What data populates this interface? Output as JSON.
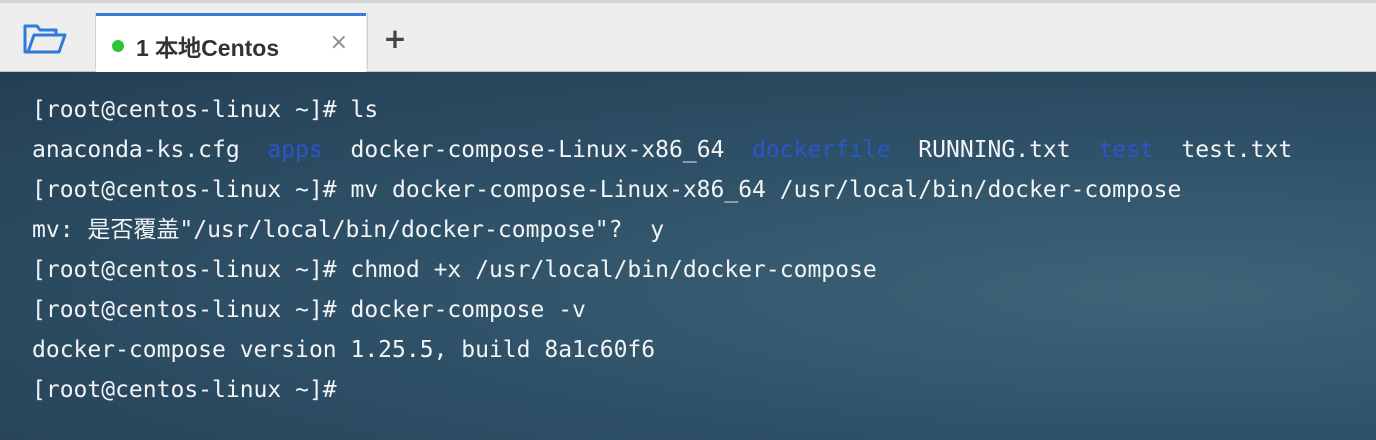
{
  "tabbar": {
    "folder_icon": "folder-open-icon",
    "tab": {
      "label": "1 本地Centos",
      "status": "connected",
      "close_icon": "×"
    },
    "add_tab_icon": "+"
  },
  "colors": {
    "tab_accent": "#3a7bd5",
    "status_dot": "#2ec438",
    "directory_text": "#2a56c8",
    "terminal_text": "#f2f4f6"
  },
  "terminal": {
    "lines": {
      "l1": "[root@centos-linux ~]# ls",
      "l2": {
        "f1": "anaconda-ks.cfg",
        "f2": "apps",
        "f3": "docker-compose-Linux-x86_64",
        "f4": "dockerfile",
        "f5": "RUNNING.txt",
        "f6": "test",
        "f7": "test.txt"
      },
      "l3": "[root@centos-linux ~]# mv docker-compose-Linux-x86_64 /usr/local/bin/docker-compose",
      "l4": "mv: 是否覆盖\"/usr/local/bin/docker-compose\"?  y",
      "l5": "[root@centos-linux ~]# chmod +x /usr/local/bin/docker-compose",
      "l6": "[root@centos-linux ~]# docker-compose -v",
      "l7": "docker-compose version 1.25.5, build 8a1c60f6",
      "l8": "[root@centos-linux ~]#"
    }
  }
}
